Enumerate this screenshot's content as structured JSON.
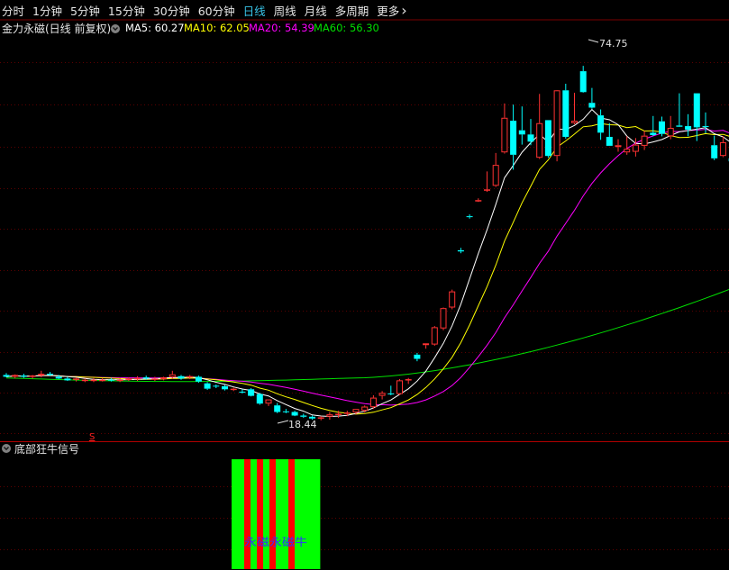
{
  "toolbar": {
    "tabs": [
      {
        "label": "分时",
        "active": false
      },
      {
        "label": "1分钟",
        "active": false
      },
      {
        "label": "5分钟",
        "active": false
      },
      {
        "label": "15分钟",
        "active": false
      },
      {
        "label": "30分钟",
        "active": false
      },
      {
        "label": "60分钟",
        "active": false
      },
      {
        "label": "日线",
        "active": true
      },
      {
        "label": "周线",
        "active": false
      },
      {
        "label": "月线",
        "active": false
      },
      {
        "label": "多周期",
        "active": false
      },
      {
        "label": "更多",
        "active": false
      }
    ]
  },
  "main_panel": {
    "title": "金力永磁(日线 前复权)",
    "ma_legend": [
      {
        "name": "MA5",
        "value": "60.27",
        "color": "#ffffff"
      },
      {
        "name": "MA10",
        "value": "62.05",
        "color": "#ffff00"
      },
      {
        "name": "MA20",
        "value": "54.39",
        "color": "#ff00ff"
      },
      {
        "name": "MA60",
        "value": "56.30",
        "color": "#00e000"
      }
    ],
    "high_label": "74.75",
    "low_label": "18.44",
    "signal_marker": "S"
  },
  "sub_panel": {
    "title": "底部狂牛信号",
    "bar_text": "永磁永磁牛"
  },
  "colors": {
    "up": "#ff3232",
    "down": "#00ffff",
    "grid": "#5a0000",
    "divider": "#b00000",
    "signal_green": "#00ff00",
    "signal_red": "#ff0000",
    "bar_text": "#3030ff"
  },
  "chart_data": {
    "type": "candlestick",
    "y_range": [
      15,
      80
    ],
    "ohlc": [
      [
        22.9,
        23.2,
        22.5,
        22.6
      ],
      [
        22.6,
        23.0,
        22.3,
        22.9
      ],
      [
        22.8,
        23.1,
        22.4,
        22.6
      ],
      [
        22.6,
        22.9,
        22.3,
        22.8
      ],
      [
        22.8,
        23.6,
        22.5,
        23.1
      ],
      [
        23.1,
        23.4,
        22.7,
        22.9
      ],
      [
        22.6,
        22.9,
        22.2,
        22.3
      ],
      [
        22.3,
        22.6,
        21.9,
        22.0
      ],
      [
        22.1,
        22.5,
        21.8,
        22.3
      ],
      [
        22.0,
        22.3,
        21.7,
        22.1
      ],
      [
        22.0,
        22.4,
        21.7,
        22.1
      ],
      [
        22.1,
        22.4,
        21.8,
        22.1
      ],
      [
        22.1,
        22.4,
        21.8,
        22.0
      ],
      [
        22.0,
        22.4,
        21.7,
        22.1
      ],
      [
        22.2,
        22.5,
        21.9,
        22.3
      ],
      [
        22.3,
        22.7,
        21.9,
        22.4
      ],
      [
        22.5,
        22.8,
        22.1,
        22.3
      ],
      [
        22.3,
        22.6,
        21.9,
        22.3
      ],
      [
        22.2,
        22.6,
        22.0,
        22.5
      ],
      [
        22.5,
        23.6,
        22.2,
        23.0
      ],
      [
        22.7,
        22.9,
        22.1,
        22.3
      ],
      [
        22.6,
        22.9,
        22.2,
        22.7
      ],
      [
        22.6,
        22.8,
        21.6,
        21.8
      ],
      [
        21.5,
        21.7,
        20.4,
        20.6
      ],
      [
        21.1,
        21.3,
        20.7,
        21.0
      ],
      [
        21.0,
        21.2,
        20.3,
        20.5
      ],
      [
        20.5,
        20.8,
        20.2,
        20.6
      ],
      [
        20.1,
        20.5,
        19.8,
        20.0
      ],
      [
        20.5,
        20.7,
        19.3,
        19.4
      ],
      [
        19.7,
        19.9,
        17.9,
        18.1
      ],
      [
        18.1,
        18.8,
        17.7,
        18.8
      ],
      [
        17.8,
        18.2,
        16.5,
        16.7
      ],
      [
        16.8,
        17.2,
        16.5,
        16.7
      ],
      [
        16.7,
        16.9,
        16.0,
        16.1
      ],
      [
        16.1,
        16.4,
        15.7,
        15.9
      ],
      [
        15.9,
        16.1,
        15.4,
        15.6
      ],
      [
        15.6,
        16.0,
        15.3,
        15.8
      ],
      [
        15.9,
        16.7,
        15.4,
        16.3
      ],
      [
        16.3,
        16.9,
        15.7,
        16.4
      ],
      [
        16.4,
        16.9,
        16.0,
        16.6
      ],
      [
        16.6,
        17.2,
        16.3,
        17.2
      ],
      [
        16.9,
        17.8,
        16.6,
        17.6
      ],
      [
        17.5,
        19.5,
        17.2,
        19.1
      ],
      [
        19.4,
        20.2,
        18.8,
        19.9
      ],
      [
        19.8,
        21.1,
        19.5,
        19.7
      ],
      [
        19.7,
        22.2,
        19.5,
        22.0
      ],
      [
        22.2,
        22.4,
        21.4,
        22.2
      ],
      [
        26.3,
        26.6,
        25.2,
        25.6
      ],
      [
        27.9,
        28.2,
        27.3,
        28.2
      ],
      [
        28.0,
        31.1,
        27.8,
        30.9
      ],
      [
        30.7,
        34.2,
        30.4,
        34.1
      ],
      [
        34.2,
        37.2,
        33.9,
        36.9
      ],
      [
        43.8,
        44.2,
        43.3,
        43.6
      ],
      [
        49.5,
        49.8,
        49.1,
        49.4
      ],
      [
        52.1,
        52.5,
        51.9,
        52.2
      ],
      [
        54.0,
        57.0,
        53.6,
        54.0
      ],
      [
        54.6,
        60.1,
        54.4,
        58.1
      ],
      [
        60.2,
        68.4,
        60.0,
        66.0
      ],
      [
        65.5,
        68.2,
        57.3,
        59.8
      ],
      [
        63.9,
        67.9,
        61.5,
        63.2
      ],
      [
        63.2,
        65.8,
        61.4,
        62.0
      ],
      [
        59.3,
        70.0,
        59.1,
        65.1
      ],
      [
        65.6,
        65.6,
        59.3,
        59.6
      ],
      [
        59.6,
        70.0,
        58.7,
        70.6
      ],
      [
        70.6,
        71.7,
        62.5,
        62.8
      ],
      [
        65.1,
        70.2,
        64.9,
        65.5
      ],
      [
        73.8,
        74.7,
        70.2,
        70.3
      ],
      [
        68.5,
        71.0,
        67.5,
        67.7
      ],
      [
        66.4,
        67.4,
        62.3,
        63.5
      ],
      [
        62.8,
        65.1,
        61.3,
        61.3
      ],
      [
        61.1,
        62.4,
        60.3,
        61.4
      ],
      [
        60.2,
        62.9,
        59.8,
        60.8
      ],
      [
        60.3,
        62.6,
        59.5,
        61.5
      ],
      [
        61.3,
        63.8,
        60.6,
        63.0
      ],
      [
        63.5,
        66.3,
        62.9,
        63.1
      ],
      [
        65.4,
        66.2,
        62.9,
        63.3
      ],
      [
        62.9,
        66.3,
        62.4,
        64.3
      ],
      [
        64.7,
        70.1,
        64.6,
        64.5
      ],
      [
        64.6,
        66.6,
        62.9,
        64.0
      ],
      [
        70.1,
        70.1,
        62.1,
        64.4
      ],
      [
        64.6,
        66.9,
        63.4,
        64.5
      ],
      [
        61.4,
        63.0,
        58.9,
        59.2
      ],
      [
        59.6,
        62.9,
        59.4,
        61.9
      ],
      [
        59.2,
        60.5,
        58.0,
        58.7
      ]
    ],
    "ma": {
      "MA5": "computed from ohlc close",
      "MA10": "computed from ohlc close",
      "MA20": "computed from ohlc close"
    },
    "signal_bars": [
      {
        "color": "green"
      },
      {
        "color": "green"
      },
      {
        "color": "red"
      },
      {
        "color": "green"
      },
      {
        "color": "red"
      },
      {
        "color": "green"
      },
      {
        "color": "red"
      },
      {
        "color": "green"
      },
      {
        "color": "green"
      },
      {
        "color": "red"
      },
      {
        "color": "green"
      },
      {
        "color": "green"
      },
      {
        "color": "green"
      },
      {
        "color": "green"
      }
    ]
  }
}
